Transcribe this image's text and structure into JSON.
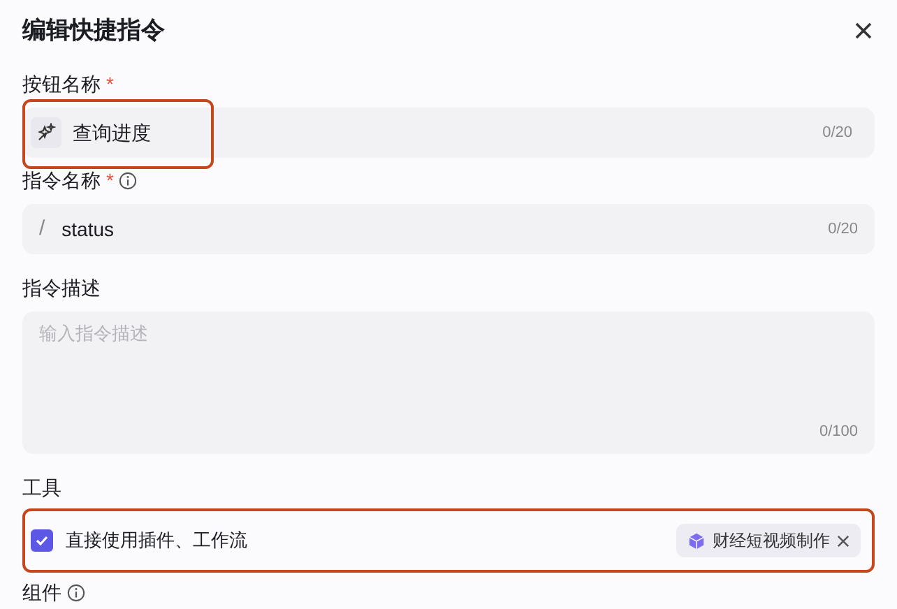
{
  "dialog": {
    "title": "编辑快捷指令"
  },
  "button_name": {
    "label": "按钮名称",
    "required_mark": "*",
    "value": "查询进度",
    "counter": "0/20",
    "highlighted": true
  },
  "command_name": {
    "label": "指令名称",
    "required_mark": "*",
    "prefix": "/",
    "value": "status",
    "counter": "0/20"
  },
  "command_description": {
    "label": "指令描述",
    "placeholder": "输入指令描述",
    "counter": "0/100"
  },
  "tools": {
    "label": "工具",
    "option": {
      "label": "直接使用插件、工作流",
      "checked": true
    },
    "highlighted": true,
    "tags": [
      {
        "label": "财经短视频制作"
      }
    ]
  },
  "components": {
    "label": "组件"
  }
}
